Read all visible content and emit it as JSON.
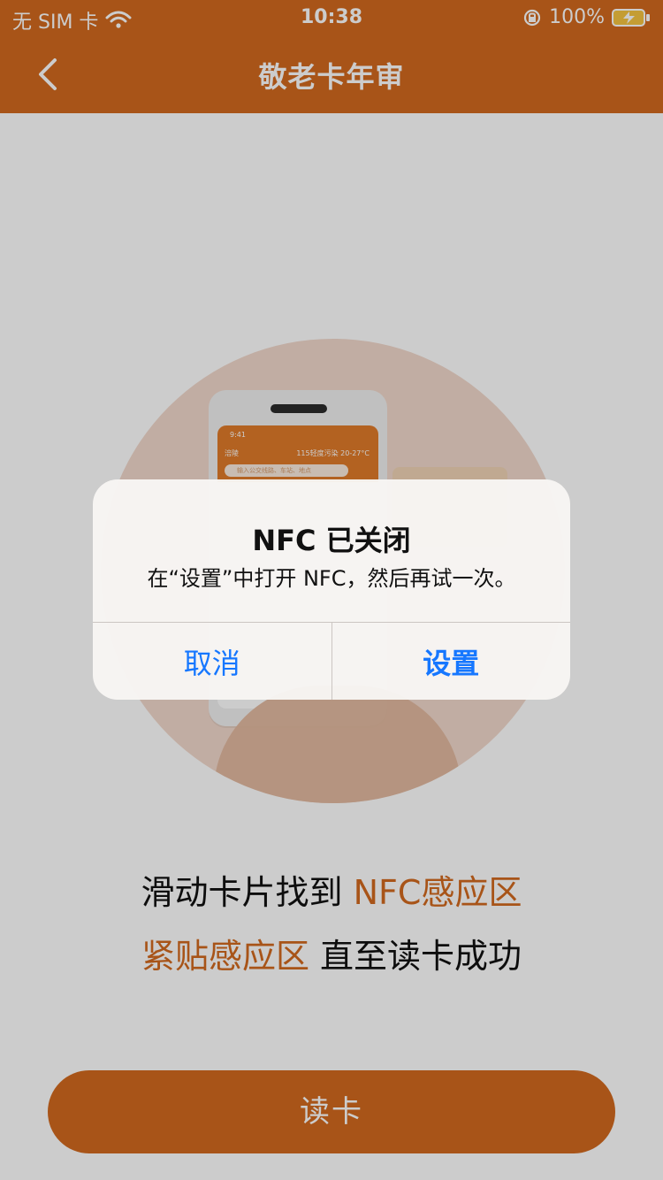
{
  "status_bar": {
    "carrier": "无 SIM 卡",
    "time": "10:38",
    "battery_percent": "100%"
  },
  "nav": {
    "title": "敬老卡年审"
  },
  "illustration": {
    "phone_screen": {
      "time": "9:41",
      "city": "涪陵",
      "weather": "115轻度污染 20-27°C",
      "search_placeholder": "输入公交线路、车站、地点"
    }
  },
  "instructions": {
    "line1_prefix": "滑动卡片找到 ",
    "line1_highlight": "NFC感应区",
    "line2_highlight": "紧贴感应区",
    "line2_suffix": " 直至读卡成功"
  },
  "main_button": {
    "label": "读卡"
  },
  "alert": {
    "title": "NFC 已关闭",
    "message": "在“设置”中打开 NFC，然后再试一次。",
    "cancel_label": "取消",
    "settings_label": "设置"
  },
  "colors": {
    "accent_orange": "#d2691e",
    "link_blue": "#1677ff"
  }
}
